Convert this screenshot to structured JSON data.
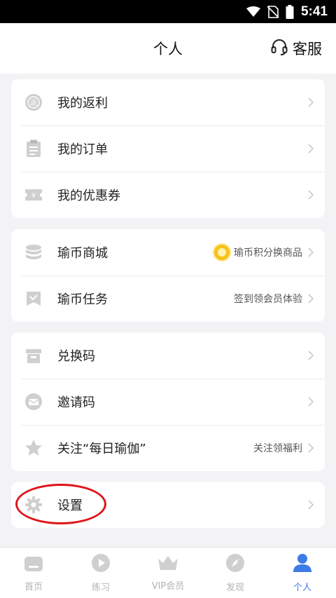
{
  "status_bar": {
    "time": "5:41"
  },
  "header": {
    "title": "个人",
    "service_label": "客服"
  },
  "groups": [
    {
      "items": [
        {
          "label": "我的返利",
          "icon": "rebate-icon",
          "extra": ""
        },
        {
          "label": "我的订单",
          "icon": "order-icon",
          "extra": ""
        },
        {
          "label": "我的优惠券",
          "icon": "coupon-icon",
          "extra": ""
        }
      ]
    },
    {
      "items": [
        {
          "label": "瑜币商城",
          "icon": "coin-stack-icon",
          "extra": "瑜币积分换商品"
        },
        {
          "label": "瑜币任务",
          "icon": "task-icon",
          "extra": "签到领会员体验"
        }
      ]
    },
    {
      "items": [
        {
          "label": "兑换码",
          "icon": "redeem-icon",
          "extra": ""
        },
        {
          "label": "邀请码",
          "icon": "invite-icon",
          "extra": ""
        },
        {
          "label": "关注“每日瑜伽”",
          "icon": "star-icon",
          "extra": "关注领福利"
        }
      ]
    },
    {
      "items": [
        {
          "label": "设置",
          "icon": "gear-icon",
          "extra": ""
        }
      ]
    }
  ],
  "tabs": [
    {
      "label": "首页",
      "icon": "home-icon",
      "active": false
    },
    {
      "label": "练习",
      "icon": "play-icon",
      "active": false
    },
    {
      "label": "VIP会员",
      "icon": "crown-icon",
      "active": false
    },
    {
      "label": "发现",
      "icon": "compass-icon",
      "active": false
    },
    {
      "label": "个人",
      "icon": "person-icon",
      "active": true
    }
  ],
  "colors": {
    "accent": "#3d7be6",
    "icon_gray": "#c8c8c8",
    "highlight": "#e0141a",
    "coin": "#f6c21b"
  }
}
